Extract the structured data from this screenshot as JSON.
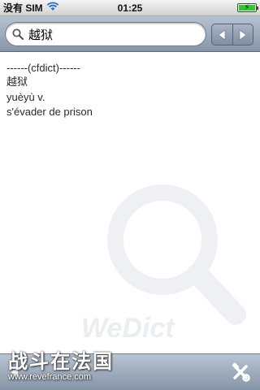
{
  "status": {
    "carrier": "没有 SIM",
    "time": "01:25",
    "wifi_icon": "wifi-icon",
    "battery_icon": "battery-charging-icon",
    "battery_level": 1.0
  },
  "search": {
    "value": "越狱",
    "icon": "search-icon"
  },
  "nav": {
    "back_icon": "triangle-left-icon",
    "forward_icon": "triangle-right-icon"
  },
  "entry": {
    "source": "------(cfdict)------",
    "headword": "越狱",
    "pinyin": "yuèyù v.",
    "definition": "s'évader de prison"
  },
  "watermark": {
    "text": "WeDict"
  },
  "toolbar": {
    "left_icon": "back-arrow-icon",
    "tools_icon": "tools-icon"
  },
  "overlay": {
    "chinese": "战斗在法国",
    "url": "www.revefrance.com"
  },
  "colors": {
    "bar_top": "#b9c4d2",
    "bar_bottom": "#8594a8",
    "battery": "#3cc03c"
  }
}
